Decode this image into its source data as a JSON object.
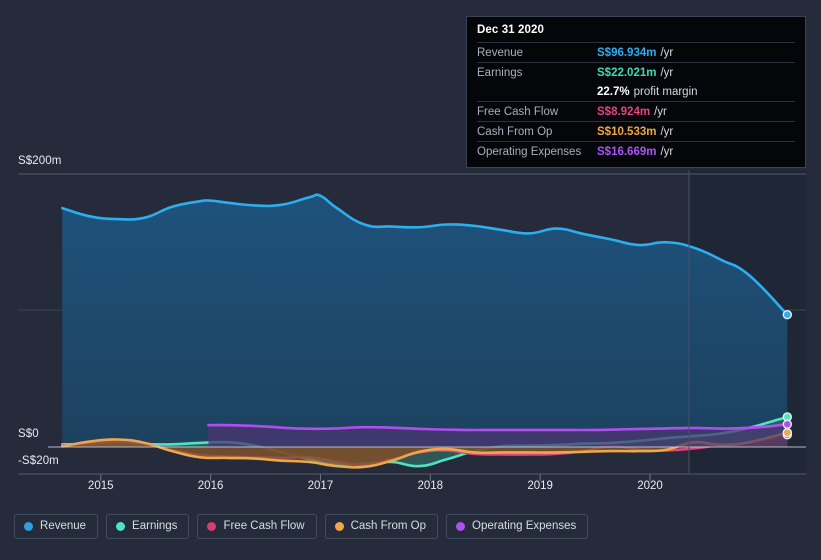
{
  "chart_data": {
    "type": "area",
    "title": "",
    "xlabel": "",
    "ylabel": "",
    "currency": "S$",
    "ylim": [
      -20,
      200
    ],
    "xlim": [
      2014.5,
      2021.4
    ],
    "grid": true,
    "legend_position": "bottom",
    "y_ticks": [
      {
        "value": 200,
        "label": "S$200m"
      },
      {
        "value": 0,
        "label": "S$0"
      },
      {
        "value": -20,
        "label": "-S$20m"
      }
    ],
    "x_ticks": [
      {
        "value": 2015,
        "label": "2015"
      },
      {
        "value": 2016,
        "label": "2016"
      },
      {
        "value": 2017,
        "label": "2017"
      },
      {
        "value": 2018,
        "label": "2018"
      },
      {
        "value": 2019,
        "label": "2019"
      },
      {
        "value": 2020,
        "label": "2020"
      }
    ],
    "forecast_divider_x": 2020.0,
    "series": [
      {
        "name": "Revenue",
        "color": "#2caef0",
        "fill": "#1d4f77",
        "x": [
          2014.65,
          2014.9,
          2015.15,
          2015.4,
          2015.65,
          2015.9,
          2016.0,
          2016.15,
          2016.4,
          2016.65,
          2016.9,
          2017.0,
          2017.15,
          2017.4,
          2017.65,
          2017.9,
          2018.15,
          2018.4,
          2018.65,
          2018.9,
          2019.15,
          2019.4,
          2019.65,
          2019.9,
          2020.15,
          2020.4,
          2020.65,
          2020.9,
          2021.25
        ],
        "values": [
          175.0,
          169.0,
          167.0,
          168.0,
          176.0,
          180.0,
          180.5,
          179.0,
          177.0,
          177.5,
          183.0,
          184.0,
          175.0,
          163.0,
          161.5,
          161.0,
          163.0,
          162.0,
          159.0,
          156.5,
          160.0,
          156.0,
          152.0,
          148.0,
          150.0,
          146.0,
          137.0,
          126.0,
          96.934
        ]
      },
      {
        "name": "Earnings",
        "color": "#4fe3c1",
        "fill": "#2f6b62",
        "x": [
          2014.65,
          2014.9,
          2015.15,
          2015.4,
          2015.65,
          2015.9,
          2016.15,
          2016.4,
          2016.65,
          2016.9,
          2017.15,
          2017.4,
          2017.65,
          2017.9,
          2018.15,
          2018.4,
          2018.65,
          2018.9,
          2019.15,
          2019.4,
          2019.65,
          2019.9,
          2020.15,
          2020.4,
          2020.65,
          2020.9,
          2021.25
        ],
        "values": [
          2.0,
          2.0,
          2.0,
          2.0,
          2.0,
          3.0,
          3.5,
          1.0,
          -4.0,
          -9.0,
          -13.0,
          -12.0,
          -11.0,
          -14.0,
          -9.0,
          -3.0,
          0.5,
          1.0,
          1.5,
          2.5,
          3.0,
          4.5,
          6.5,
          8.0,
          10.0,
          14.0,
          22.021
        ]
      },
      {
        "name": "Free Cash Flow",
        "color": "#e0437f",
        "fill": "#6e2434",
        "x": [
          2014.65,
          2014.9,
          2015.15,
          2015.4,
          2015.65,
          2015.9,
          2016.15,
          2016.4,
          2016.65,
          2016.9,
          2017.15,
          2017.4,
          2017.65,
          2017.9,
          2018.15,
          2018.4,
          2018.65,
          2018.9,
          2019.15,
          2019.4,
          2019.65,
          2019.9,
          2020.15,
          2020.4,
          2020.65,
          2020.9,
          2021.25
        ],
        "values": [
          1.0,
          2.5,
          4.0,
          2.0,
          -2.0,
          -6.0,
          -7.0,
          -7.5,
          -8.0,
          -7.5,
          -11.0,
          -13.0,
          -9.0,
          -4.0,
          -2.5,
          -5.0,
          -5.5,
          -5.5,
          -5.0,
          -3.0,
          0.5,
          -2.0,
          -2.5,
          -1.0,
          1.5,
          3.0,
          8.924
        ]
      },
      {
        "name": "Cash From Op",
        "color": "#eda84b",
        "fill": "#7a5a29",
        "x": [
          2014.65,
          2014.9,
          2015.15,
          2015.4,
          2015.65,
          2015.9,
          2016.15,
          2016.4,
          2016.65,
          2016.9,
          2017.15,
          2017.4,
          2017.65,
          2017.9,
          2018.15,
          2018.4,
          2018.65,
          2018.9,
          2019.15,
          2019.4,
          2019.65,
          2019.9,
          2020.15,
          2020.4,
          2020.65,
          2020.9,
          2021.25
        ],
        "values": [
          0.5,
          4.0,
          5.5,
          3.0,
          -3.0,
          -7.5,
          -8.0,
          -8.5,
          -10.0,
          -11.0,
          -14.0,
          -14.5,
          -10.0,
          -3.5,
          -1.5,
          -4.0,
          -4.0,
          -4.0,
          -4.0,
          -3.5,
          -3.0,
          -3.0,
          -2.0,
          3.5,
          1.5,
          3.5,
          10.533
        ]
      },
      {
        "name": "Operating Expenses",
        "color": "#b14ef0",
        "fill": "#4b3470",
        "x": [
          2015.98,
          2016.2,
          2016.5,
          2016.8,
          2017.1,
          2017.4,
          2017.7,
          2018.0,
          2018.3,
          2018.6,
          2018.9,
          2019.2,
          2019.5,
          2019.8,
          2020.1,
          2020.4,
          2020.7,
          2021.0,
          2021.25
        ],
        "values": [
          16.0,
          16.0,
          15.0,
          13.5,
          13.5,
          14.5,
          14.0,
          13.0,
          12.5,
          12.5,
          12.5,
          12.5,
          12.5,
          13.0,
          13.5,
          14.0,
          13.5,
          14.5,
          16.669
        ]
      }
    ]
  },
  "tooltip": {
    "date": "Dec 31 2020",
    "rows": [
      {
        "name": "Revenue",
        "value": "S$96.934m",
        "unit": "/yr",
        "color": "#2caef0",
        "rule": true
      },
      {
        "name": "Earnings",
        "value": "S$22.021m",
        "unit": "/yr",
        "color": "#3ddbb4",
        "rule": true
      },
      {
        "name": "",
        "value": "22.7%",
        "unit": "profit margin",
        "color": "#ffffff",
        "rule": false
      },
      {
        "name": "Free Cash Flow",
        "value": "S$8.924m",
        "unit": "/yr",
        "color": "#e8437f",
        "rule": true
      },
      {
        "name": "Cash From Op",
        "value": "S$10.533m",
        "unit": "/yr",
        "color": "#f0a93f",
        "rule": true
      },
      {
        "name": "Operating Expenses",
        "value": "S$16.669m",
        "unit": "/yr",
        "color": "#a855f7",
        "rule": true
      }
    ]
  },
  "legend": {
    "items": [
      {
        "label": "Revenue",
        "color": "#2f9fe0"
      },
      {
        "label": "Earnings",
        "color": "#4fe3c1"
      },
      {
        "label": "Free Cash Flow",
        "color": "#d63f72"
      },
      {
        "label": "Cash From Op",
        "color": "#eda84b"
      },
      {
        "label": "Operating Expenses",
        "color": "#b14ef0"
      }
    ]
  },
  "axis": {
    "y200": "S$200m",
    "y0": "S$0",
    "yneg": "-S$20m"
  }
}
